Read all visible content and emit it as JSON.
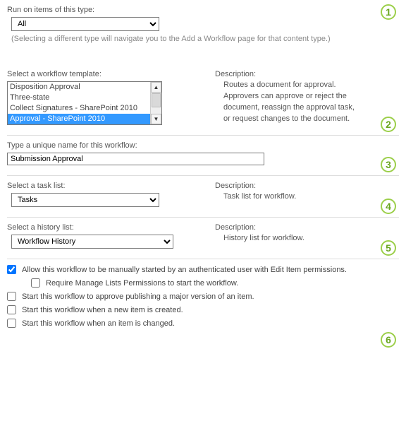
{
  "step1": {
    "label": "Run on items of this type:",
    "select_value": "All",
    "hint": "(Selecting a different type will navigate you to the Add a Workflow page for that content type.)",
    "badge": "1"
  },
  "step2": {
    "label": "Select a workflow template:",
    "items": [
      "Disposition Approval",
      "Three-state",
      "Collect Signatures - SharePoint 2010",
      "Approval - SharePoint 2010"
    ],
    "selected_index": 3,
    "desc_head": "Description:",
    "desc_body": "Routes a document for approval.\nApprovers can approve or reject the\ndocument, reassign the approval task,\nor request changes to the document.",
    "badge": "2"
  },
  "step3": {
    "label": "Type a unique name for this workflow:",
    "value": "Submission Approval",
    "badge": "3"
  },
  "step4": {
    "label": "Select a task list:",
    "select_value": "Tasks",
    "desc_head": "Description:",
    "desc_body": "Task list for workflow.",
    "badge": "4"
  },
  "step5": {
    "label": "Select a history list:",
    "select_value": "Workflow History",
    "desc_head": "Description:",
    "desc_body": "History list for workflow.",
    "badge": "5"
  },
  "step6": {
    "checks": [
      {
        "label": "Allow this workflow to be manually started by an authenticated user with Edit Item permissions.",
        "checked": true,
        "indent": false
      },
      {
        "label": "Require Manage Lists Permissions to start the workflow.",
        "checked": false,
        "indent": true
      },
      {
        "label": "Start this workflow to approve publishing a major version of an item.",
        "checked": false,
        "indent": false
      },
      {
        "label": "Start this workflow when a new item is created.",
        "checked": false,
        "indent": false
      },
      {
        "label": "Start this workflow when an item is changed.",
        "checked": false,
        "indent": false
      }
    ],
    "badge": "6"
  }
}
